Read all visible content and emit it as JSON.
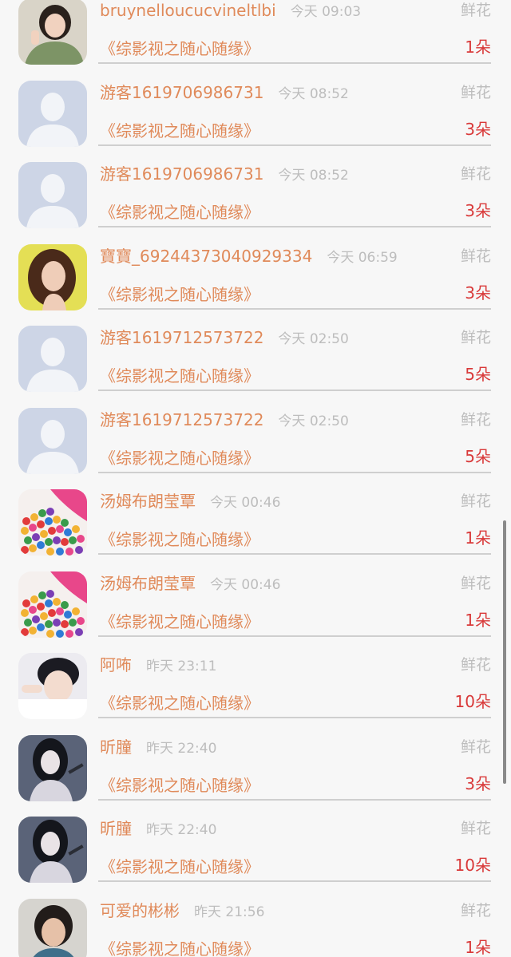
{
  "list": {
    "rows": [
      {
        "avatar": "photo-girl-green-sweater",
        "name": "bruynelloucucvineltlbi",
        "time": "今天 09:03",
        "gift": "鲜花",
        "program": "《综影视之随心随缘》",
        "count": "1朵"
      },
      {
        "avatar": "default-person",
        "name": "游客1619706986731",
        "time": "今天 08:52",
        "gift": "鲜花",
        "program": "《综影视之随心随缘》",
        "count": "3朵"
      },
      {
        "avatar": "default-person",
        "name": "游客1619706986731",
        "time": "今天 08:52",
        "gift": "鲜花",
        "program": "《综影视之随心随缘》",
        "count": "3朵"
      },
      {
        "avatar": "photo-woman-curly-hair",
        "name": "寶寶_69244373040929334",
        "time": "今天 06:59",
        "gift": "鲜花",
        "program": "《综影视之随心随缘》",
        "count": "3朵"
      },
      {
        "avatar": "default-person",
        "name": "游客1619712573722",
        "time": "今天 02:50",
        "gift": "鲜花",
        "program": "《综影视之随心随缘》",
        "count": "5朵"
      },
      {
        "avatar": "default-person",
        "name": "游客1619712573722",
        "time": "今天 02:50",
        "gift": "鲜花",
        "program": "《综影视之随心随缘》",
        "count": "5朵"
      },
      {
        "avatar": "photo-colorful-candy",
        "name": "汤姆布朗莹覃",
        "time": "今天 00:46",
        "gift": "鲜花",
        "program": "《综影视之随心随缘》",
        "count": "1朵"
      },
      {
        "avatar": "photo-colorful-candy",
        "name": "汤姆布朗莹覃",
        "time": "今天 00:46",
        "gift": "鲜花",
        "program": "《综影视之随心随缘》",
        "count": "1朵"
      },
      {
        "avatar": "photo-young-man-sleeping",
        "name": "阿咘",
        "time": "昨天 23:11",
        "gift": "鲜花",
        "program": "《综影视之随心随缘》",
        "count": "10朵"
      },
      {
        "avatar": "illustration-dark-hair-girl",
        "name": "昕朣",
        "time": "昨天 22:40",
        "gift": "鲜花",
        "program": "《综影视之随心随缘》",
        "count": "3朵"
      },
      {
        "avatar": "illustration-dark-hair-girl",
        "name": "昕朣",
        "time": "昨天 22:40",
        "gift": "鲜花",
        "program": "《综影视之随心随缘》",
        "count": "10朵"
      },
      {
        "avatar": "photo-girl-short-hair",
        "name": "可爱的彬彬",
        "time": "昨天 21:56",
        "gift": "鲜花",
        "program": "《综影视之随心随缘》",
        "count": "1朵"
      }
    ]
  }
}
